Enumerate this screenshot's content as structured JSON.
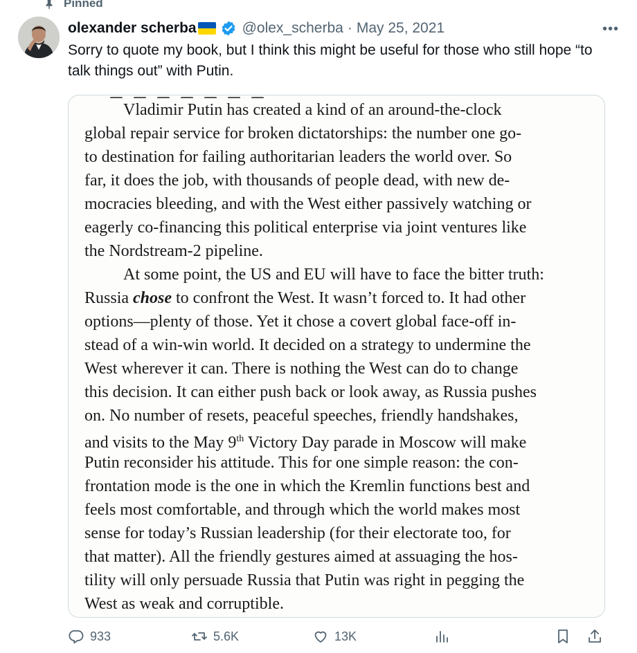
{
  "pinned": {
    "label": "Pinned",
    "icon": "pin-icon"
  },
  "author": {
    "name": "olexander scherba",
    "flag": "ukraine-flag-emoji",
    "verified_icon": "verified-badge-icon",
    "handle": "@olex_scherba",
    "separator": "·",
    "date": "May 25, 2021"
  },
  "menu": {
    "more_icon": "more-dots-icon",
    "more_label": "•••"
  },
  "tweet": {
    "text": "Sorry to quote my book, but I think this might be useful for those who still hope “to talk things out” with Putin."
  },
  "media": {
    "paragraph1_lines": [
      "Vladimir Putin has created a kind of an around-the-clock",
      "global repair service for broken dictatorships: the number one go-",
      "to destination for failing authoritarian leaders the world over. So",
      "far, it does the job, with thousands of people dead, with new de-",
      "mocracies bleeding, and with the West either passively watching or",
      "eagerly co-financing this political enterprise via joint ventures like",
      "the Nordstream-2 pipeline."
    ],
    "p2_l1": "At some point, the US and EU will have to face the bitter truth:",
    "p2_l2_a": "Russia ",
    "p2_l2_em": "chose",
    "p2_l2_b": " to confront the West. It wasn’t forced to. It had other",
    "p2_l3": "options—plenty of those. Yet it chose a covert global face-off in-",
    "p2_l4": "stead of a win-win world. It decided on a strategy to undermine the",
    "p2_l5": "West wherever it can. There is nothing the West can do to change",
    "p2_l6": "this decision. It can either push back or look away, as Russia pushes",
    "p2_l7": "on. No number of resets, peaceful speeches, friendly handshakes,",
    "p2_l8_a": "and visits to the May 9",
    "p2_l8_sup": "th",
    "p2_l8_b": " Victory Day parade in Moscow will make",
    "p2_l9": "Putin reconsider his attitude. This for one simple reason: the con-",
    "p2_l10": "frontation mode is the one in which the Kremlin functions best and",
    "p2_l11": "feels most comfortable, and through which the world makes most",
    "p2_l12": "sense for today’s Russian leadership (for their electorate too, for",
    "p2_l13": "that matter). All the friendly gestures aimed at assuaging the hos-",
    "p2_l14": "tility will only persuade Russia that Putin was right in pegging the",
    "p2_l15": "West as weak and corruptible."
  },
  "actions": {
    "reply": {
      "icon": "reply-icon",
      "count": "933"
    },
    "retweet": {
      "icon": "retweet-icon",
      "count": "5.6K"
    },
    "like": {
      "icon": "heart-icon",
      "count": "13K"
    },
    "views": {
      "icon": "views-chart-icon"
    },
    "bookmark": {
      "icon": "bookmark-icon"
    },
    "share": {
      "icon": "share-icon"
    }
  },
  "colors": {
    "text": "#0f1419",
    "secondary": "#536471",
    "verified": "#1d9bf0",
    "border": "#cfd9de",
    "flag_blue": "#0057b7",
    "flag_yellow": "#ffd700"
  }
}
